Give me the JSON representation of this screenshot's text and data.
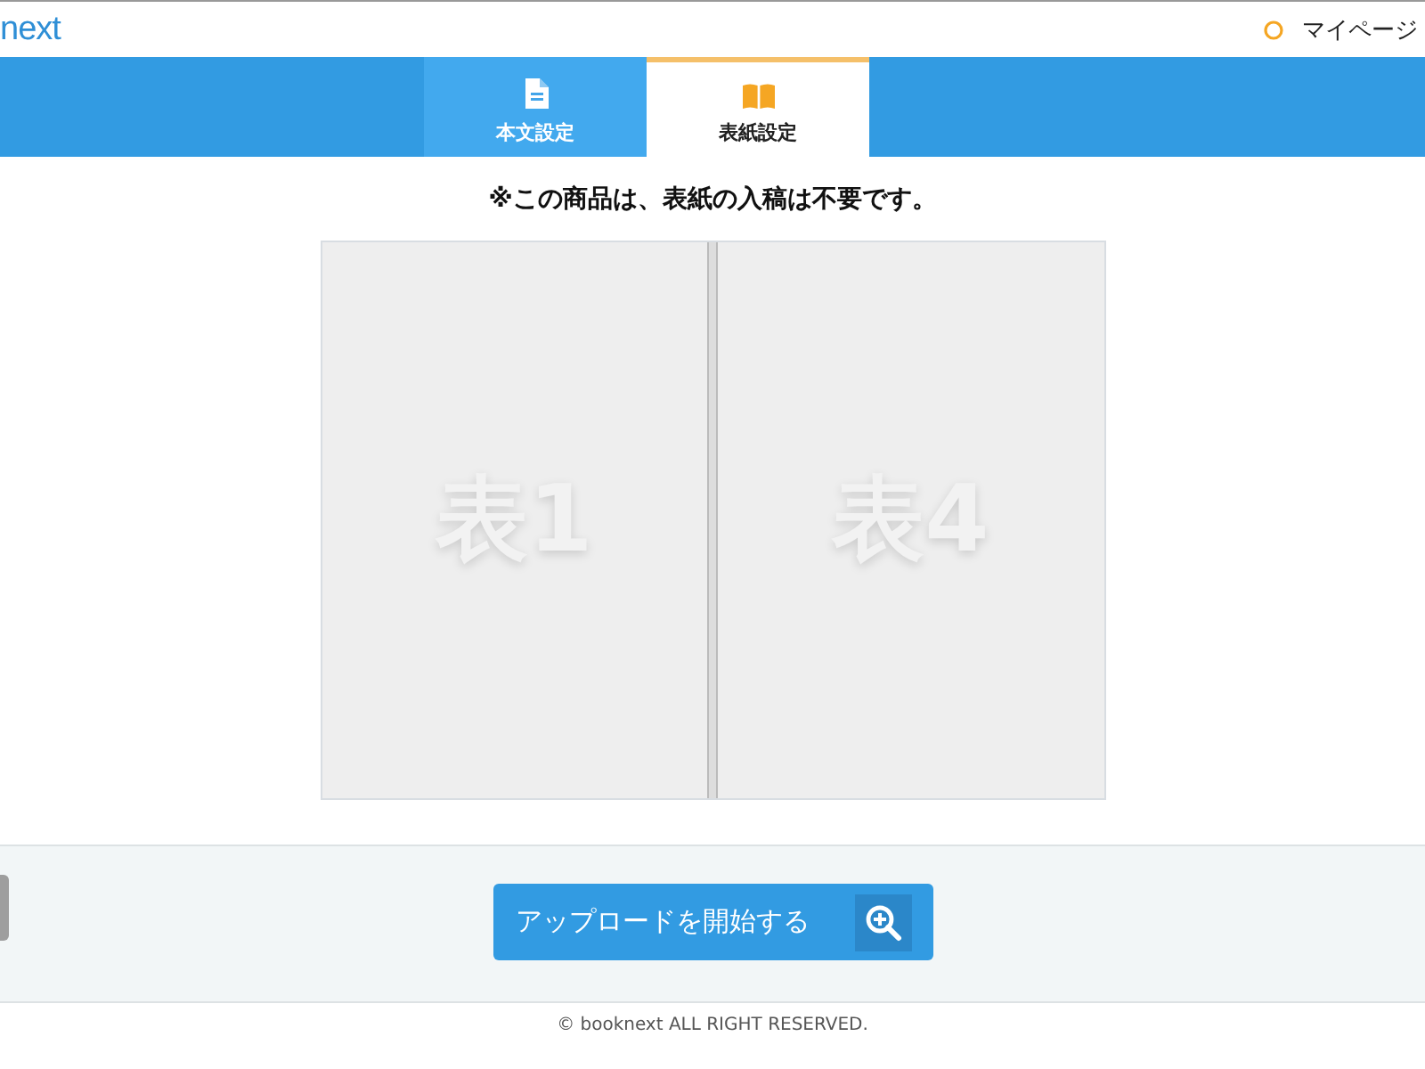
{
  "header": {
    "logo": "next",
    "mypage": "マイページ"
  },
  "tabs": [
    {
      "label": "本文設定",
      "kind": "document",
      "selected": false
    },
    {
      "label": "表紙設定",
      "kind": "book",
      "selected": true
    }
  ],
  "notice": "※この商品は、表紙の入稿は不要です。",
  "pages": [
    {
      "label": "表1"
    },
    {
      "label": "表4"
    }
  ],
  "upload_button": "アップロードを開始する",
  "footer": "© booknext ALL RIGHT RESERVED."
}
